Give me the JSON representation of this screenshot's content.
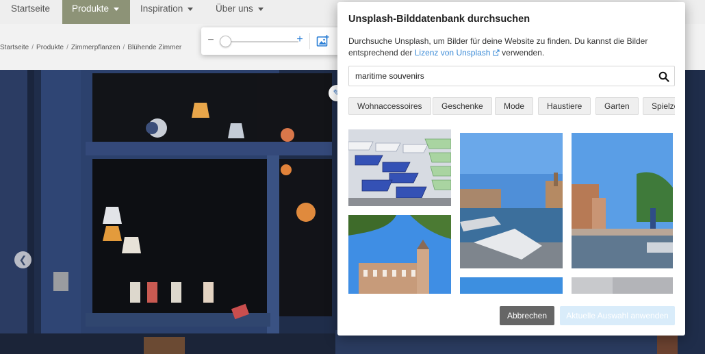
{
  "nav": {
    "items": [
      {
        "label": "Startseite"
      },
      {
        "label": "Produkte"
      },
      {
        "label": "Inspiration"
      },
      {
        "label": "Über uns"
      }
    ]
  },
  "breadcrumb": [
    "Startseite",
    "Produkte",
    "Zimmerpflanzen",
    "Blühende Zimmer"
  ],
  "zoom": {
    "level": 0
  },
  "modal": {
    "title": "Unsplash-Bilddatenbank durchsuchen",
    "desc_before": "Durchsuche Unsplash, um Bilder für deine Website zu finden. Du kannst die Bilder entsprechend der ",
    "license_link": "Lizenz von Unsplash",
    "desc_after": " verwenden.",
    "search": {
      "value": "maritime souvenirs"
    },
    "tags": [
      "Wohnaccessoires",
      "Geschenke",
      "Mode",
      "Haustiere",
      "Garten",
      "Spielzeug"
    ],
    "cancel_label": "Abbrechen",
    "apply_label": "Aktuelle Auswahl anwenden"
  },
  "colors": {
    "nav_active": "#8d9377",
    "link": "#3a8ad6",
    "primary_disabled": "#d9ecfa",
    "cancel": "#666666"
  }
}
